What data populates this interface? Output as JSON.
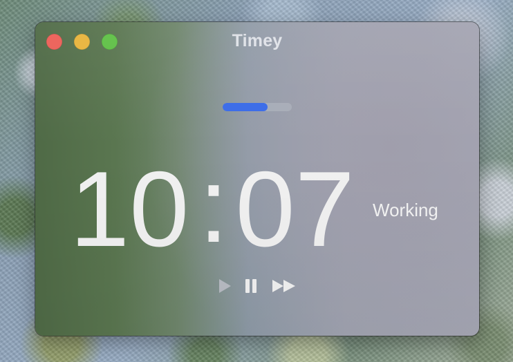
{
  "window": {
    "title": "Timey"
  },
  "colors": {
    "close": "#ec5f57",
    "minimize": "#e8b43c",
    "zoom": "#5fc046",
    "accent": "#3b6ce8",
    "play_icon": "#b8bcc4",
    "active_icon": "#f2f2f2"
  },
  "progress": {
    "fraction": 0.65
  },
  "timer": {
    "minutes": "10",
    "separator": ":",
    "seconds": "07",
    "status": "Working"
  },
  "controls": {
    "icons": [
      "play-icon",
      "pause-icon",
      "skip-forward-icon"
    ]
  }
}
